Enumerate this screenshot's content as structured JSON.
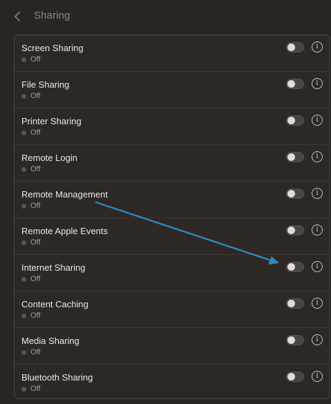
{
  "header": {
    "title": "Sharing",
    "back_icon": "chevron-left-icon"
  },
  "colors": {
    "background": "#2b2522",
    "annotation_arrow": "#2f86b8"
  },
  "services": [
    {
      "name": "Screen Sharing",
      "status": "Off",
      "enabled": false
    },
    {
      "name": "File Sharing",
      "status": "Off",
      "enabled": false
    },
    {
      "name": "Printer Sharing",
      "status": "Off",
      "enabled": false
    },
    {
      "name": "Remote Login",
      "status": "Off",
      "enabled": false
    },
    {
      "name": "Remote Management",
      "status": "Off",
      "enabled": false
    },
    {
      "name": "Remote Apple Events",
      "status": "Off",
      "enabled": false
    },
    {
      "name": "Internet Sharing",
      "status": "Off",
      "enabled": false
    },
    {
      "name": "Content Caching",
      "status": "Off",
      "enabled": false
    },
    {
      "name": "Media Sharing",
      "status": "Off",
      "enabled": false
    },
    {
      "name": "Bluetooth Sharing",
      "status": "Off",
      "enabled": false
    }
  ],
  "info_glyph": "i"
}
